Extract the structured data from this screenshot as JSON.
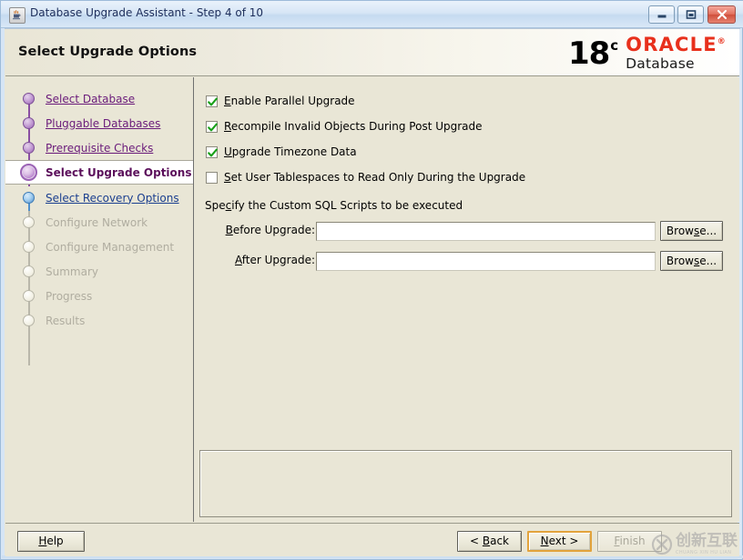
{
  "window": {
    "title": "Database Upgrade Assistant - Step 4 of 10",
    "icon": "java-coffee-cup-icon",
    "controls": {
      "minimize": "minimize-button",
      "maximize": "maximize-button",
      "close": "close-button"
    }
  },
  "header": {
    "page_title": "Select Upgrade Options",
    "logo": {
      "version": "18",
      "version_suffix": "c",
      "brand": "ORACLE",
      "product": "Database",
      "brand_color": "#e8301c"
    }
  },
  "sidebar": {
    "steps": [
      {
        "label": "Select Database",
        "state": "done"
      },
      {
        "label": "Pluggable Databases",
        "state": "done"
      },
      {
        "label": "Prerequisite Checks",
        "state": "done"
      },
      {
        "label": "Select Upgrade Options",
        "state": "current"
      },
      {
        "label": "Select Recovery Options",
        "state": "next"
      },
      {
        "label": "Configure Network",
        "state": "todo"
      },
      {
        "label": "Configure Management",
        "state": "todo"
      },
      {
        "label": "Summary",
        "state": "todo"
      },
      {
        "label": "Progress",
        "state": "todo"
      },
      {
        "label": "Results",
        "state": "todo"
      }
    ],
    "colors": {
      "done": "#6a1b7a",
      "current": "#5b0f5b",
      "next": "#1b3f8f",
      "todo": "#b0ada0"
    }
  },
  "main": {
    "checkboxes": [
      {
        "label": "Enable Parallel Upgrade",
        "mnemonic": "E",
        "checked": true
      },
      {
        "label": "Recompile Invalid Objects During Post Upgrade",
        "mnemonic": "R",
        "checked": true
      },
      {
        "label": "Upgrade Timezone Data",
        "mnemonic": "U",
        "checked": true
      },
      {
        "label": "Set User Tablespaces to Read Only During the Upgrade",
        "mnemonic": "S",
        "checked": false
      }
    ],
    "scripts": {
      "section_label": "Specify the Custom SQL Scripts to be executed",
      "section_label_mnemonic": "c",
      "fields": [
        {
          "label": "Before Upgrade:",
          "mnemonic": "B",
          "value": "",
          "button": "Browse...",
          "button_mnemonic": "s"
        },
        {
          "label": "After Upgrade:",
          "mnemonic": "A",
          "value": "",
          "button": "Browse...",
          "button_mnemonic": "s"
        }
      ]
    },
    "message_panel": {
      "text": ""
    }
  },
  "footer": {
    "help": {
      "label": "Help",
      "mnemonic": "H",
      "enabled": true
    },
    "back": {
      "label": "< Back",
      "mnemonic": "B",
      "enabled": true
    },
    "next": {
      "label": "Next >",
      "mnemonic": "N",
      "enabled": true,
      "focused": true
    },
    "finish": {
      "label": "Finish",
      "mnemonic": "F",
      "enabled": false
    }
  },
  "watermark": {
    "chinese": "创新互联",
    "pinyin": "CHUANG XIN HU LIAN",
    "logo": "circle-x-logo"
  }
}
